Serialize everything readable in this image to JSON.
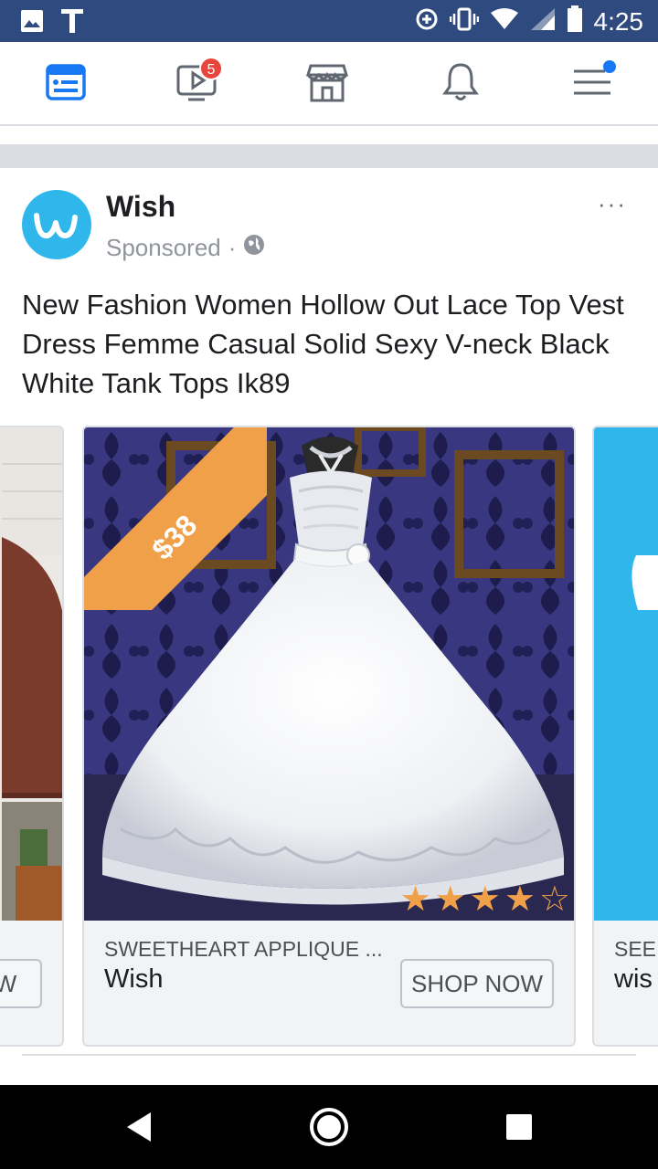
{
  "status_bar": {
    "time": "4:25",
    "left_icons": [
      "image-icon",
      "t-icon"
    ],
    "right_icons": [
      "data-saver-icon",
      "vibrate-icon",
      "wifi-icon",
      "signal-icon",
      "battery-icon"
    ]
  },
  "nav": {
    "items": [
      {
        "name": "news-feed",
        "icon": "news-feed-icon",
        "active": true
      },
      {
        "name": "watch",
        "icon": "watch-icon",
        "badge": "5"
      },
      {
        "name": "marketplace",
        "icon": "marketplace-icon"
      },
      {
        "name": "notifications",
        "icon": "bell-icon"
      },
      {
        "name": "menu",
        "icon": "menu-icon",
        "dot": true
      }
    ],
    "active_color": "#1877f2"
  },
  "post": {
    "page_name": "Wish",
    "sponsored": "Sponsored",
    "privacy_icon": "globe-icon",
    "more": "···",
    "text": "New Fashion Women Hollow Out Lace Top Vest Dress Femme Casual Solid Sexy V-neck Black White Tank Tops Ik89",
    "avatar_color": "#2fb7ec"
  },
  "carousel": {
    "prev_card": {
      "button_partial": "W"
    },
    "main_card": {
      "price": "$38",
      "rating": 4,
      "max_rating": 5,
      "title": "SWEETHEART APPLIQUE ...",
      "subtitle": "Wish",
      "button": "SHOP NOW"
    },
    "next_card": {
      "title_partial": "SEE",
      "subtitle_partial": "wis"
    }
  }
}
